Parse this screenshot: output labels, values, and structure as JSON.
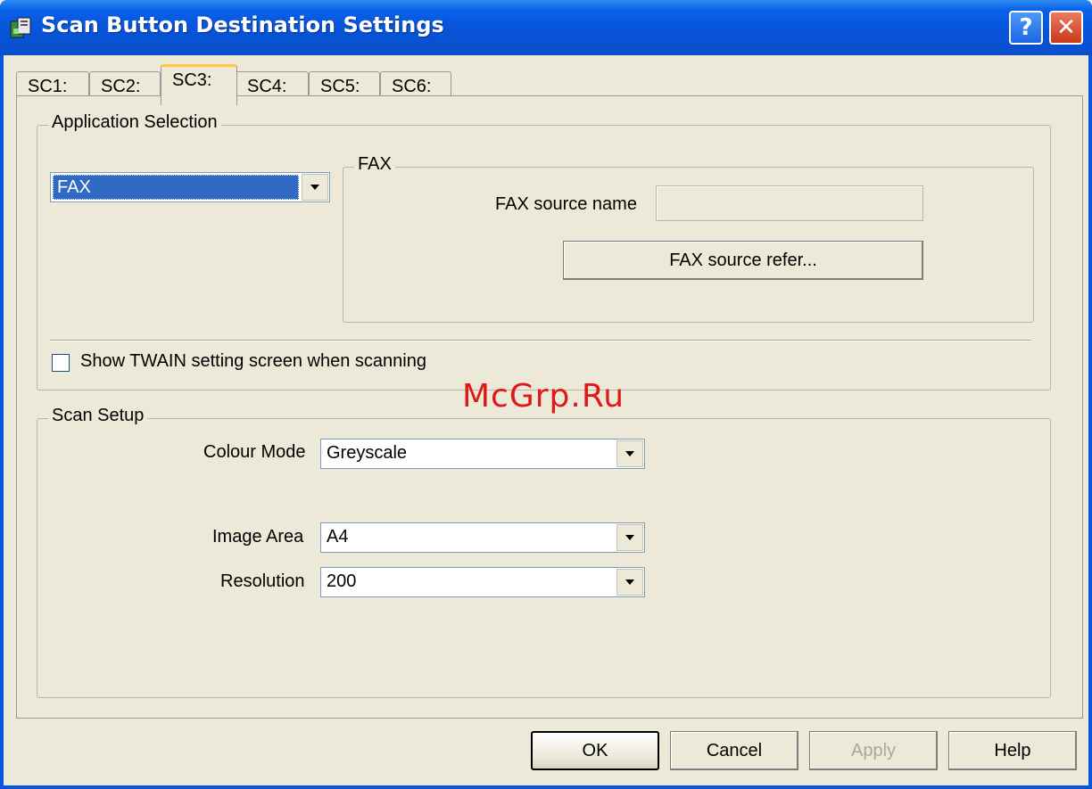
{
  "window": {
    "title": "Scan Button Destination Settings",
    "help_label": "?",
    "close_label": "✕"
  },
  "tabs": [
    {
      "label": "SC1:"
    },
    {
      "label": "SC2:"
    },
    {
      "label": "SC3:",
      "active": true
    },
    {
      "label": "SC4:"
    },
    {
      "label": "SC5:"
    },
    {
      "label": "SC6:"
    }
  ],
  "application_selection": {
    "group_label": "Application Selection",
    "application_value": "FAX",
    "fax_group_label": "FAX",
    "fax_source_name_label": "FAX source name",
    "fax_source_name_value": "",
    "fax_source_refer_label": "FAX source refer...",
    "show_twain_label": "Show TWAIN setting screen when scanning",
    "show_twain_checked": false
  },
  "scan_setup": {
    "group_label": "Scan Setup",
    "colour_mode_label": "Colour Mode",
    "colour_mode_value": "Greyscale",
    "image_area_label": "Image Area",
    "image_area_value": "A4",
    "resolution_label": "Resolution",
    "resolution_value": "200"
  },
  "buttons": {
    "ok": "OK",
    "cancel": "Cancel",
    "apply": "Apply",
    "help": "Help"
  },
  "watermark": "McGrp.Ru"
}
